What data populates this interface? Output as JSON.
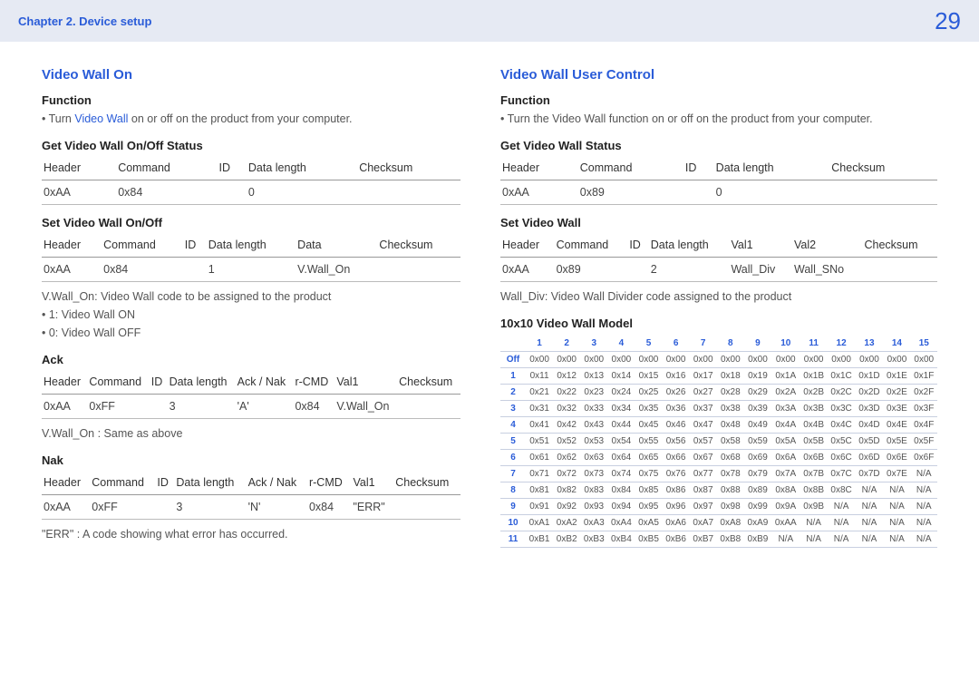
{
  "header": {
    "chapter": "Chapter 2. Device setup",
    "page": "29"
  },
  "left": {
    "title": "Video Wall On",
    "function_h": "Function",
    "function_pre": "Turn ",
    "function_hl": "Video Wall",
    "function_post": " on or off on the product from your computer.",
    "get_h": "Get Video Wall On/Off Status",
    "get_table": {
      "head": [
        "Header",
        "Command",
        "ID",
        "Data length",
        "Checksum"
      ],
      "row": [
        "0xAA",
        "0x84",
        "",
        "0",
        ""
      ]
    },
    "set_h": "Set Video Wall On/Off",
    "set_table": {
      "head": [
        "Header",
        "Command",
        "ID",
        "Data length",
        "Data",
        "Checksum"
      ],
      "row": [
        "0xAA",
        "0x84",
        "",
        "1",
        "V.Wall_On",
        ""
      ]
    },
    "set_desc": "V.Wall_On: Video Wall code to be assigned to the product",
    "set_opt1": "1: Video Wall ON",
    "set_opt0": "0: Video Wall OFF",
    "ack_h": "Ack",
    "ack_table": {
      "head": [
        "Header",
        "Command",
        "ID",
        "Data length",
        "Ack / Nak",
        "r-CMD",
        "Val1",
        "Checksum"
      ],
      "row": [
        "0xAA",
        "0xFF",
        "",
        "3",
        "'A'",
        "0x84",
        "V.Wall_On",
        ""
      ]
    },
    "ack_desc": "V.Wall_On : Same as above",
    "nak_h": "Nak",
    "nak_table": {
      "head": [
        "Header",
        "Command",
        "ID",
        "Data length",
        "Ack / Nak",
        "r-CMD",
        "Val1",
        "Checksum"
      ],
      "row": [
        "0xAA",
        "0xFF",
        "",
        "3",
        "'N'",
        "0x84",
        "\"ERR\"",
        ""
      ]
    },
    "nak_desc": "\"ERR\" : A code showing what error has occurred."
  },
  "right": {
    "title": "Video Wall User Control",
    "function_h": "Function",
    "function_text": "Turn the Video Wall function on or off on the product from your computer.",
    "get_h": "Get Video Wall Status",
    "get_table": {
      "head": [
        "Header",
        "Command",
        "ID",
        "Data length",
        "Checksum"
      ],
      "row": [
        "0xAA",
        "0x89",
        "",
        "0",
        ""
      ]
    },
    "set_h": "Set Video Wall",
    "set_table": {
      "head": [
        "Header",
        "Command",
        "ID",
        "Data length",
        "Val1",
        "Val2",
        "Checksum"
      ],
      "row": [
        "0xAA",
        "0x89",
        "",
        "2",
        "Wall_Div",
        "Wall_SNo",
        ""
      ]
    },
    "set_desc": "Wall_Div: Video Wall Divider code assigned to the product",
    "grid_h": "10x10 Video Wall Model",
    "grid": {
      "cols": [
        "1",
        "2",
        "3",
        "4",
        "5",
        "6",
        "7",
        "8",
        "9",
        "10",
        "11",
        "12",
        "13",
        "14",
        "15"
      ],
      "rows": [
        {
          "h": "Off",
          "v": [
            "0x00",
            "0x00",
            "0x00",
            "0x00",
            "0x00",
            "0x00",
            "0x00",
            "0x00",
            "0x00",
            "0x00",
            "0x00",
            "0x00",
            "0x00",
            "0x00",
            "0x00"
          ]
        },
        {
          "h": "1",
          "v": [
            "0x11",
            "0x12",
            "0x13",
            "0x14",
            "0x15",
            "0x16",
            "0x17",
            "0x18",
            "0x19",
            "0x1A",
            "0x1B",
            "0x1C",
            "0x1D",
            "0x1E",
            "0x1F"
          ]
        },
        {
          "h": "2",
          "v": [
            "0x21",
            "0x22",
            "0x23",
            "0x24",
            "0x25",
            "0x26",
            "0x27",
            "0x28",
            "0x29",
            "0x2A",
            "0x2B",
            "0x2C",
            "0x2D",
            "0x2E",
            "0x2F"
          ]
        },
        {
          "h": "3",
          "v": [
            "0x31",
            "0x32",
            "0x33",
            "0x34",
            "0x35",
            "0x36",
            "0x37",
            "0x38",
            "0x39",
            "0x3A",
            "0x3B",
            "0x3C",
            "0x3D",
            "0x3E",
            "0x3F"
          ]
        },
        {
          "h": "4",
          "v": [
            "0x41",
            "0x42",
            "0x43",
            "0x44",
            "0x45",
            "0x46",
            "0x47",
            "0x48",
            "0x49",
            "0x4A",
            "0x4B",
            "0x4C",
            "0x4D",
            "0x4E",
            "0x4F"
          ]
        },
        {
          "h": "5",
          "v": [
            "0x51",
            "0x52",
            "0x53",
            "0x54",
            "0x55",
            "0x56",
            "0x57",
            "0x58",
            "0x59",
            "0x5A",
            "0x5B",
            "0x5C",
            "0x5D",
            "0x5E",
            "0x5F"
          ]
        },
        {
          "h": "6",
          "v": [
            "0x61",
            "0x62",
            "0x63",
            "0x64",
            "0x65",
            "0x66",
            "0x67",
            "0x68",
            "0x69",
            "0x6A",
            "0x6B",
            "0x6C",
            "0x6D",
            "0x6E",
            "0x6F"
          ]
        },
        {
          "h": "7",
          "v": [
            "0x71",
            "0x72",
            "0x73",
            "0x74",
            "0x75",
            "0x76",
            "0x77",
            "0x78",
            "0x79",
            "0x7A",
            "0x7B",
            "0x7C",
            "0x7D",
            "0x7E",
            "N/A"
          ]
        },
        {
          "h": "8",
          "v": [
            "0x81",
            "0x82",
            "0x83",
            "0x84",
            "0x85",
            "0x86",
            "0x87",
            "0x88",
            "0x89",
            "0x8A",
            "0x8B",
            "0x8C",
            "N/A",
            "N/A",
            "N/A"
          ]
        },
        {
          "h": "9",
          "v": [
            "0x91",
            "0x92",
            "0x93",
            "0x94",
            "0x95",
            "0x96",
            "0x97",
            "0x98",
            "0x99",
            "0x9A",
            "0x9B",
            "N/A",
            "N/A",
            "N/A",
            "N/A"
          ]
        },
        {
          "h": "10",
          "v": [
            "0xA1",
            "0xA2",
            "0xA3",
            "0xA4",
            "0xA5",
            "0xA6",
            "0xA7",
            "0xA8",
            "0xA9",
            "0xAA",
            "N/A",
            "N/A",
            "N/A",
            "N/A",
            "N/A"
          ]
        },
        {
          "h": "11",
          "v": [
            "0xB1",
            "0xB2",
            "0xB3",
            "0xB4",
            "0xB5",
            "0xB6",
            "0xB7",
            "0xB8",
            "0xB9",
            "N/A",
            "N/A",
            "N/A",
            "N/A",
            "N/A",
            "N/A"
          ]
        }
      ]
    }
  }
}
